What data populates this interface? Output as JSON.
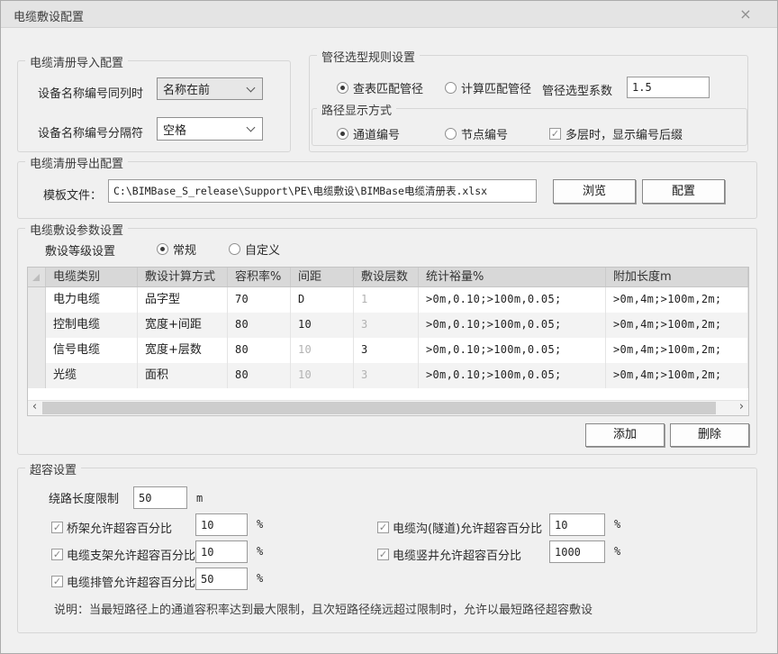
{
  "window": {
    "title": "电缆敷设配置"
  },
  "icons": {
    "close": "×",
    "scroll_left": "‹",
    "scroll_right": "›",
    "check": "✓"
  },
  "colors": {
    "titlebar": "#e4e4e4",
    "dialog_bg": "#f0f0f0",
    "table_header_bg": "#d8d8d8",
    "muted_text": "#b2b2b2"
  },
  "import_group": {
    "title": "电缆清册导入配置",
    "name_order_label": "设备名称编号同列时",
    "name_order_value": "名称在前",
    "separator_label": "设备名称编号分隔符",
    "separator_value": "空格"
  },
  "pipe_group": {
    "title": "管径选型规则设置",
    "lookup_radio": "查表匹配管径",
    "calc_radio": "计算匹配管径",
    "coef_label": "管径选型系数",
    "coef_value": "1.5",
    "path_display": {
      "title": "路径显示方式",
      "channel_radio": "通道编号",
      "node_radio": "节点编号",
      "suffix_checkbox": "多层时，显示编号后缀"
    }
  },
  "export_group": {
    "title": "电缆清册导出配置",
    "template_label": "模板文件：",
    "template_path": "C:\\BIMBase_S_release\\Support\\PE\\电缆敷设\\BIMBase电缆清册表.xlsx",
    "browse_button": "浏览",
    "config_button": "配置"
  },
  "params_group": {
    "title": "电缆敷设参数设置",
    "level_label": "敷设等级设置",
    "normal_radio": "常规",
    "custom_radio": "自定义",
    "table": {
      "headers": [
        "电缆类别",
        "敷设计算方式",
        "容积率%",
        "间距",
        "敷设层数",
        "统计裕量%",
        "附加长度m"
      ],
      "rows": [
        {
          "cells": [
            "电力电缆",
            "品字型",
            "70",
            "D",
            "1",
            ">0m,0.10;>100m,0.05;",
            ">0m,4m;>100m,2m;"
          ]
        },
        {
          "cells": [
            "控制电缆",
            "宽度+间距",
            "80",
            "10",
            "3",
            ">0m,0.10;>100m,0.05;",
            ">0m,4m;>100m,2m;"
          ]
        },
        {
          "cells": [
            "信号电缆",
            "宽度+层数",
            "80",
            "10",
            "3",
            ">0m,0.10;>100m,0.05;",
            ">0m,4m;>100m,2m;"
          ]
        },
        {
          "cells": [
            "光缆",
            "面积",
            "80",
            "10",
            "3",
            ">0m,0.10;>100m,0.05;",
            ">0m,4m;>100m,2m;"
          ]
        }
      ],
      "muted_cells": [
        [
          4
        ],
        [
          4
        ],
        [
          3
        ],
        [
          3,
          4
        ]
      ]
    },
    "add_button": "添加",
    "delete_button": "删除"
  },
  "overcap_group": {
    "title": "超容设置",
    "detour_label": "绕路长度限制",
    "detour_value": "50",
    "detour_unit": "m",
    "percent_unit": "%",
    "left_items": [
      {
        "label": "桥架允许超容百分比",
        "value": "10"
      },
      {
        "label": "电缆支架允许超容百分比",
        "value": "10"
      },
      {
        "label": "电缆排管允许超容百分比",
        "value": "50"
      }
    ],
    "right_items": [
      {
        "label": "电缆沟(隧道)允许超容百分比",
        "value": "10"
      },
      {
        "label": "电缆竖井允许超容百分比",
        "value": "1000"
      }
    ],
    "note": "说明：当最短路径上的通道容积率达到最大限制，且次短路径绕远超过限制时，允许以最短路径超容敷设"
  }
}
